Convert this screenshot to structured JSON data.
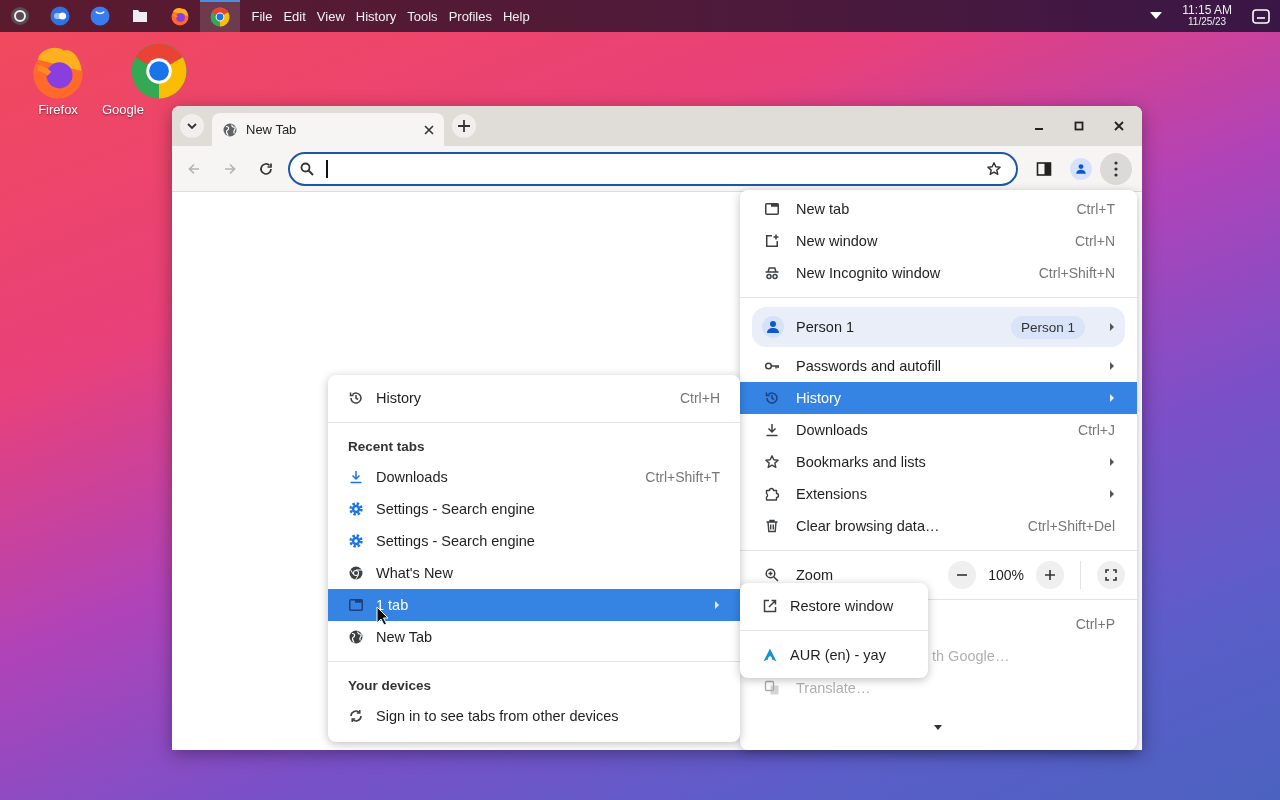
{
  "taskbar": {
    "apps": [
      {
        "kind": "launcher",
        "selected": false
      },
      {
        "kind": "toggle",
        "selected": false
      },
      {
        "kind": "messenger",
        "selected": false
      },
      {
        "kind": "files",
        "selected": false
      },
      {
        "kind": "firefox",
        "selected": false
      },
      {
        "kind": "chrome",
        "selected": true
      }
    ],
    "menus": [
      "File",
      "Edit",
      "View",
      "History",
      "Tools",
      "Profiles",
      "Help"
    ],
    "clock": {
      "time": "11:15 AM",
      "date": "11/25/23"
    }
  },
  "desktop_icons": [
    {
      "kind": "firefox",
      "label": "Firefox"
    },
    {
      "kind": "chrome",
      "label": "Google"
    }
  ],
  "browser": {
    "tabs": [
      {
        "title": "New Tab",
        "selected": true
      }
    ],
    "nav_buttons": [
      {
        "kind": "back",
        "disabled": true
      },
      {
        "kind": "forward",
        "disabled": true
      },
      {
        "kind": "reload",
        "disabled": false
      }
    ]
  },
  "app_menu": {
    "sections": [
      {
        "items": [
          {
            "kind": "item",
            "label": "New tab",
            "shortcut": "Ctrl+T",
            "submenu": false,
            "selected": false,
            "disabled": false
          },
          {
            "kind": "item",
            "label": "New window",
            "shortcut": "Ctrl+N",
            "submenu": false,
            "selected": false,
            "disabled": false
          },
          {
            "kind": "item",
            "label": "New Incognito window",
            "shortcut": "Ctrl+Shift+N",
            "submenu": false,
            "selected": false,
            "disabled": false
          }
        ]
      },
      {
        "items": [
          {
            "kind": "profile",
            "label": "Person 1",
            "badge": "Person 1",
            "submenu": true,
            "selected": false,
            "disabled": false
          },
          {
            "kind": "item",
            "label": "Passwords and autofill",
            "submenu": true,
            "selected": false,
            "disabled": false
          },
          {
            "kind": "item",
            "label": "History",
            "submenu": true,
            "selected": true,
            "disabled": false
          },
          {
            "kind": "item",
            "label": "Downloads",
            "shortcut": "Ctrl+J",
            "submenu": false,
            "selected": false,
            "disabled": false
          },
          {
            "kind": "item",
            "label": "Bookmarks and lists",
            "submenu": true,
            "selected": false,
            "disabled": false
          },
          {
            "kind": "item",
            "label": "Extensions",
            "submenu": true,
            "selected": false,
            "disabled": false
          },
          {
            "kind": "item",
            "label": "Clear browsing data…",
            "shortcut": "Ctrl+Shift+Del",
            "submenu": false,
            "selected": false,
            "disabled": false
          }
        ]
      },
      {
        "items": [
          {
            "kind": "zoom",
            "label": "Zoom",
            "value": "100%"
          }
        ]
      },
      {
        "items": [
          {
            "kind": "item",
            "shortcut": "Ctrl+P",
            "submenu": false,
            "selected": false,
            "disabled": false
          },
          {
            "kind": "partial",
            "label": "th Google…",
            "submenu": false,
            "selected": false,
            "disabled": true
          },
          {
            "kind": "item",
            "label": "Translate…",
            "submenu": false,
            "selected": false,
            "disabled": true
          }
        ]
      }
    ],
    "more_below": true
  },
  "history_menu": {
    "sections": [
      {
        "items": [
          {
            "label": "History",
            "shortcut": "Ctrl+H",
            "submenu": false,
            "selected": false
          }
        ]
      },
      {
        "heading": "Recent tabs",
        "items": [
          {
            "label": "Downloads",
            "shortcut": "Ctrl+Shift+T",
            "submenu": false,
            "selected": false
          },
          {
            "label": "Settings - Search engine",
            "submenu": false,
            "selected": false
          },
          {
            "label": "Settings - Search engine",
            "submenu": false,
            "selected": false
          },
          {
            "label": "What's New",
            "submenu": false,
            "selected": false
          },
          {
            "label": "1 tab",
            "submenu": true,
            "selected": true
          },
          {
            "label": "New Tab",
            "submenu": false,
            "selected": false
          }
        ]
      },
      {
        "heading": "Your devices",
        "items": [
          {
            "label": "Sign in to see tabs from other devices",
            "submenu": false,
            "selected": false
          }
        ]
      }
    ]
  },
  "tab_menu": {
    "sections": [
      {
        "items": [
          {
            "label": "Restore window",
            "selected": false
          }
        ]
      },
      {
        "items": [
          {
            "label": "AUR (en) - yay",
            "selected": false
          }
        ]
      }
    ]
  }
}
